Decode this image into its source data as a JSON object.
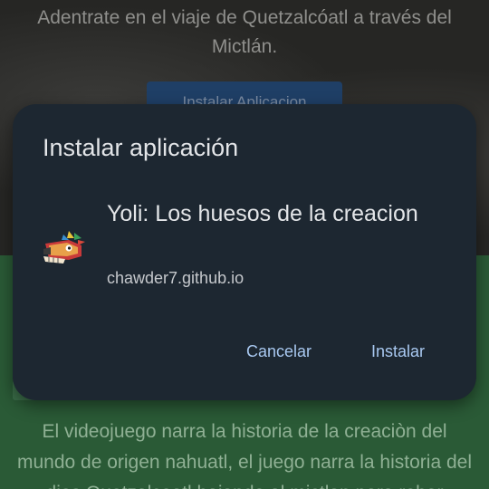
{
  "background": {
    "subtitle": "Adentrate en el viaje de Quetzalcóatl a través del Mictlán.",
    "install_button_label": "Instalar Aplicacion",
    "paragraph": "El videojuego narra la historia de la creaciòn del mundo de origen nahuatl, el juego narra la historia del dios Quetzalcoatl bajando al mictlan para robar"
  },
  "dialog": {
    "title": "Instalar aplicación",
    "app_name": "Yoli: Los huesos de la creacion",
    "app_url": "chawder7.github.io",
    "app_icon": "feathered-serpent-icon",
    "cancel_label": "Cancelar",
    "install_label": "Instalar"
  },
  "colors": {
    "dialog_bg": "#1d2731",
    "accent": "#a8c8f0",
    "page_green": "#2a5a36"
  }
}
